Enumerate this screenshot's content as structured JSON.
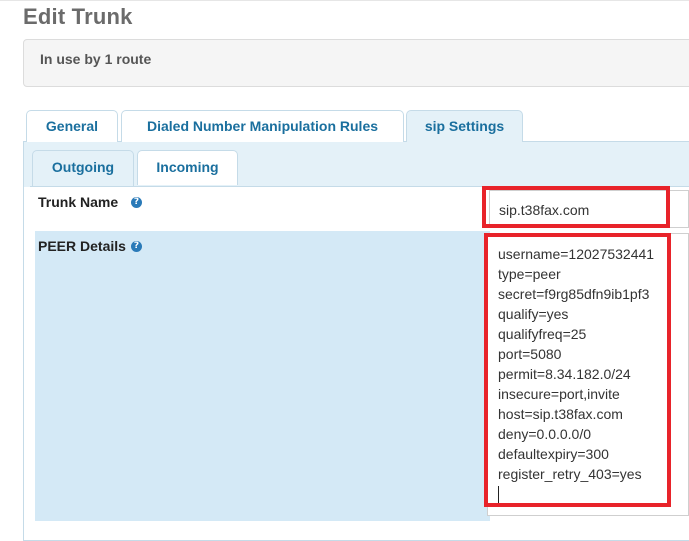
{
  "page": {
    "title": "Edit Trunk"
  },
  "info": {
    "text": "In use by 1 route"
  },
  "tabs": [
    {
      "label": "General"
    },
    {
      "label": "Dialed Number Manipulation Rules"
    },
    {
      "label": "sip Settings"
    }
  ],
  "subtabs": [
    {
      "label": "Outgoing"
    },
    {
      "label": "Incoming"
    }
  ],
  "trunk_name": {
    "label": "Trunk Name",
    "value": "sip.t38fax.com",
    "help": "?"
  },
  "peer_details": {
    "label": "PEER Details",
    "help": "?",
    "lines": [
      "username=12027532441",
      "type=peer",
      "secret=f9rg85dfn9ib1pf3",
      "qualify=yes",
      "qualifyfreq=25",
      "port=5080",
      "permit=8.34.182.0/24",
      "insecure=port,invite",
      "host=sip.t38fax.com",
      "deny=0.0.0.0/0",
      "defaultexpiry=300",
      "register_retry_403=yes"
    ]
  },
  "colors": {
    "accent": "#1a6f9e",
    "highlight": "#e8232a",
    "peer_background": "#d4e9f6"
  }
}
